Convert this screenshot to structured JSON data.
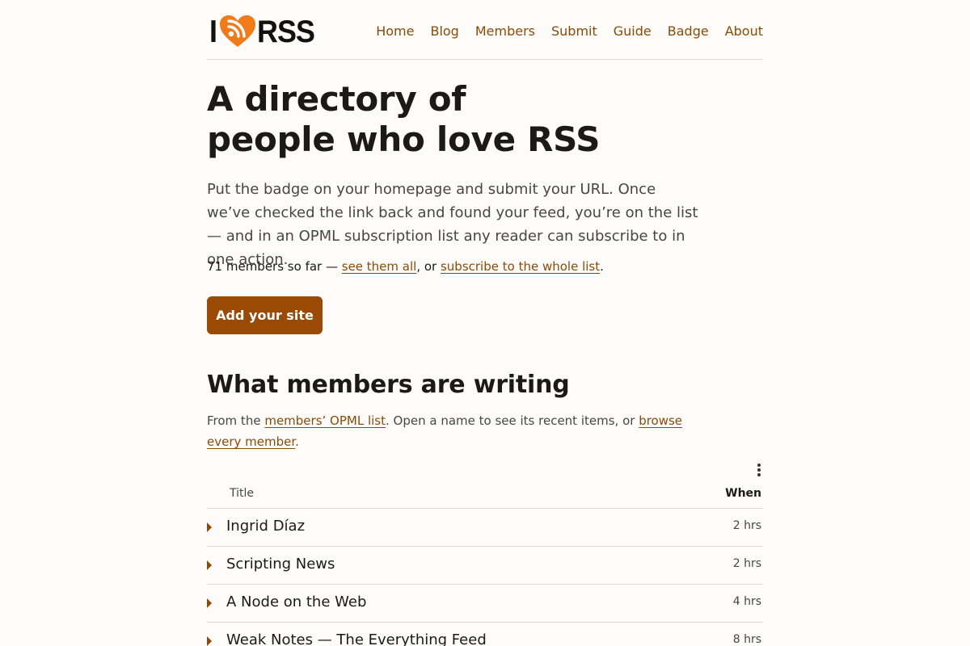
{
  "logo": {
    "i": "I",
    "rss": "RSS",
    "icon": "heart-rss-icon"
  },
  "nav": {
    "items": [
      {
        "label": "Home"
      },
      {
        "label": "Blog"
      },
      {
        "label": "Members"
      },
      {
        "label": "Submit"
      },
      {
        "label": "Guide"
      },
      {
        "label": "Badge"
      },
      {
        "label": "About"
      }
    ]
  },
  "hero": {
    "title_line1": "A directory of",
    "title_line2": "people who love RSS",
    "intro": "Put the badge on your homepage and submit your URL. Once we’ve checked the link back and found your feed, you’re on the list — and in an OPML subscription list any reader can subscribe to in one action.",
    "count_prefix": "71 members so far — ",
    "see_all_link": "see them all",
    "count_middle": ", or ",
    "subscribe_link": "subscribe to the whole list",
    "count_suffix": ".",
    "add_button": "Add your site"
  },
  "feed_section": {
    "title": "What members are writing",
    "desc_prefix": "From the ",
    "opml_link": "members’ OPML list",
    "desc_middle": ". Open a name to see its recent items, or ",
    "browse_link": "browse every member",
    "desc_suffix": ".",
    "more_icon": "more-vertical-icon",
    "columns": {
      "title": "Title",
      "when": "When"
    },
    "rows": [
      {
        "title": "Ingrid Díaz",
        "when": "2 hrs"
      },
      {
        "title": "Scripting News",
        "when": "2 hrs"
      },
      {
        "title": "A Node on the Web",
        "when": "4 hrs"
      },
      {
        "title": "Weak Notes — The Everything Feed",
        "when": "8 hrs"
      }
    ]
  },
  "colors": {
    "accent": "#8b4a06",
    "button": "#9a4a05",
    "logo_heart": "#f07b1a",
    "background": "#fdfcfa"
  }
}
